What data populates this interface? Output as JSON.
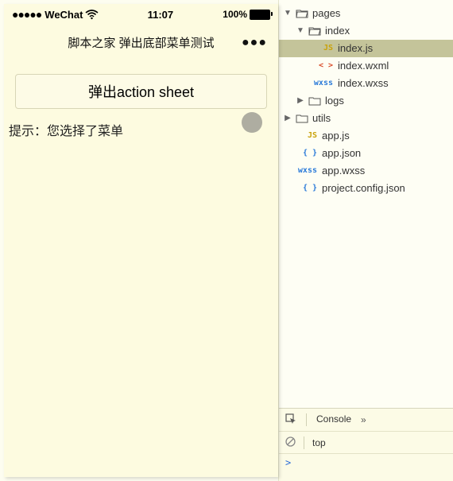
{
  "status": {
    "carrier": "WeChat",
    "time": "11:07",
    "battery_pct": "100%"
  },
  "nav": {
    "title": "脚本之家 弹出底部菜单测试",
    "menu_glyph": "●●●"
  },
  "page": {
    "button_label": "弹出action sheet",
    "hint_text": "提示：您选择了菜单"
  },
  "tree": {
    "pages": "pages",
    "index_folder": "index",
    "index_js": "index.js",
    "index_wxml": "index.wxml",
    "index_wxss": "index.wxss",
    "logs": "logs",
    "utils": "utils",
    "app_js": "app.js",
    "app_json": "app.json",
    "app_wxss": "app.wxss",
    "project_config": "project.config.json",
    "ft_js": "JS",
    "ft_wxml": "< >",
    "ft_wxss": "wxss",
    "ft_json": "{ }"
  },
  "console": {
    "tab_label": "Console",
    "chevron": "»",
    "context": "top",
    "prompt": ">"
  }
}
